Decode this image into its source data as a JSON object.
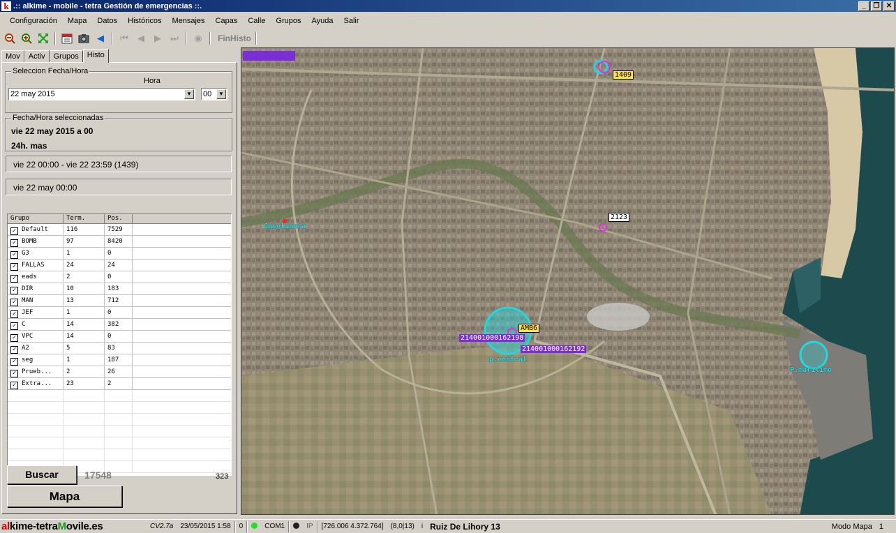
{
  "window": {
    "title": ".:: alkime - mobile - tetra Gestión de emergencias ::.",
    "app_icon": "k"
  },
  "menu": [
    "Configuración",
    "Mapa",
    "Datos",
    "Históricos",
    "Mensajes",
    "Capas",
    "Calle",
    "Grupos",
    "Ayuda",
    "Salir"
  ],
  "toolbar": {
    "finhisto_label": "FinHisto"
  },
  "tabs": [
    "Mov",
    "Activ",
    "Grupos",
    "Histo"
  ],
  "histo": {
    "select_legend": "Seleccion Fecha/Hora",
    "hora_label": "Hora",
    "date_value": "22 may 2015",
    "hour_value": "00",
    "selected_legend": "Fecha/Hora seleccionadas",
    "selected_line1": "vie 22 may 2015 a 00",
    "selected_line2": "24h. mas",
    "range_text": "vie 22 00:00 - vie 22 23:59 (1439)",
    "current_text": "vie 22 may 00:00"
  },
  "grid": {
    "headers": [
      "Grupo",
      "Term.",
      "Pos."
    ],
    "rows": [
      {
        "name": "Default",
        "term": "116",
        "pos": "7529"
      },
      {
        "name": "BOMB",
        "term": "97",
        "pos": "8420"
      },
      {
        "name": "G3",
        "term": "1",
        "pos": "0"
      },
      {
        "name": "FALLAS",
        "term": "24",
        "pos": "24"
      },
      {
        "name": "eads",
        "term": "2",
        "pos": "0"
      },
      {
        "name": "DIR",
        "term": "10",
        "pos": "183"
      },
      {
        "name": "MAN",
        "term": "13",
        "pos": "712"
      },
      {
        "name": "JEF",
        "term": "1",
        "pos": "0"
      },
      {
        "name": "C",
        "term": "14",
        "pos": "382"
      },
      {
        "name": "VPC",
        "term": "14",
        "pos": "0"
      },
      {
        "name": "A2",
        "term": "5",
        "pos": "83"
      },
      {
        "name": "seg",
        "term": "1",
        "pos": "187"
      },
      {
        "name": "Prueb...",
        "term": "2",
        "pos": "26"
      },
      {
        "name": "Extra...",
        "term": "23",
        "pos": "2"
      }
    ]
  },
  "buttons": {
    "buscar": "Buscar",
    "mapa": "Mapa"
  },
  "counts": {
    "total": "17548",
    "small": "323"
  },
  "map": {
    "labels": {
      "l1409": "1409",
      "l2123": "2123",
      "amb6": "AMB6",
      "id1": "214001000162198",
      "id2": "214001000162192",
      "gasolinera": "Gasolinera",
      "pcentral": "p.central",
      "pmaritimo": "P.maritimo"
    },
    "colors": {
      "marker_cyan": "#22d8e0",
      "marker_magenta": "#e030e0",
      "purple": "#7a2fd6",
      "yellow": "#ffe23a"
    }
  },
  "status": {
    "brand_a": "al",
    "brand_b": "k",
    "brand_c": "ime-tetra",
    "brand_d": "M",
    "brand_e": "ovile.es",
    "version": "CV2.7a",
    "datetime": "23/05/2015 1:58",
    "zero": "0",
    "com": "COM1",
    "ip": "IP",
    "coords": "[726.006 4.372.764]",
    "zoom": "(8,0|13)",
    "i": "i",
    "street": "Ruiz De Lihory 13",
    "mode": "Modo Mapa",
    "mode_num": "1"
  }
}
